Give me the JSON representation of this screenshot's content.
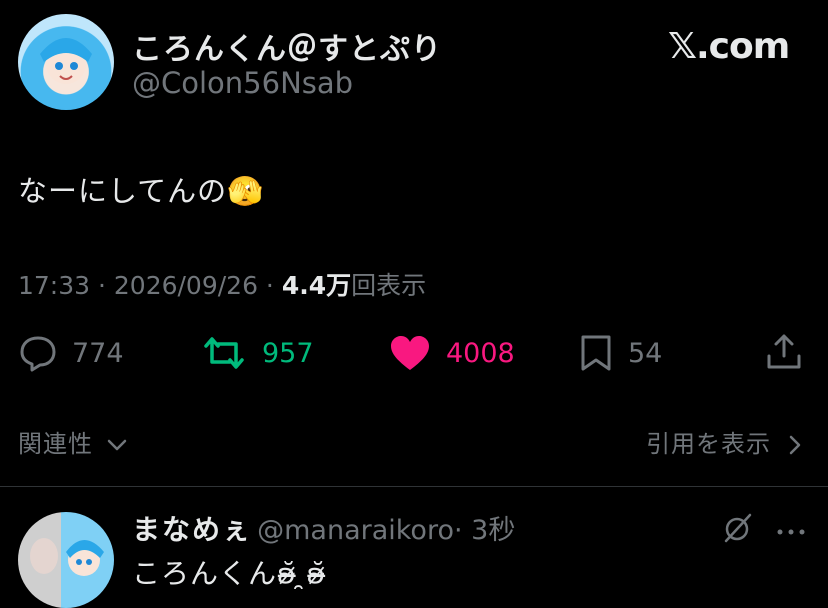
{
  "tweet": {
    "display_name": "ころんくん＠すとぷり",
    "handle": "@Colon56Nsab",
    "brand": "𝕏.com",
    "text": "なーにしてんの",
    "emoji": "🫣",
    "time": "17:33 · 2026/09/26 · ",
    "views_count": "4.4万",
    "views_label": "回表示"
  },
  "actions": {
    "replies": "774",
    "retweets": "957",
    "likes": "4008",
    "bookmarks": "54"
  },
  "related": {
    "left_label": "関連性",
    "right_label": "引用を表示"
  },
  "reply": {
    "name": "まなめぇ",
    "handle": "@manaraikoro",
    "time": "· 3秒",
    "text": "ころんくん",
    "kaomoji": "ʚ̴̶̷̆ ̯ʚ̴̶̷̆"
  },
  "colors": {
    "retweet": "#00ba7c",
    "like": "#f91880",
    "muted": "#71767b"
  }
}
